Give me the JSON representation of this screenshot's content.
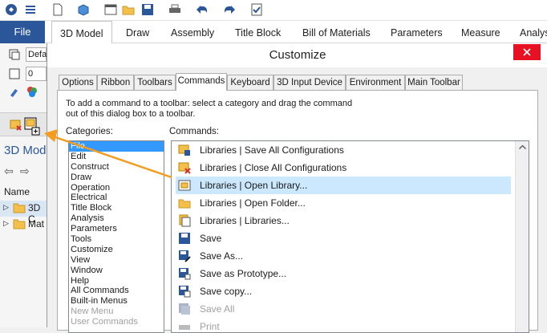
{
  "ribbon": {
    "file": "File",
    "tabs": [
      "3D Model",
      "Draw",
      "Assembly",
      "Title Block",
      "Bill of Materials",
      "Parameters",
      "Measure",
      "Analys"
    ]
  },
  "left": {
    "input1": "Defa",
    "input2": "0",
    "tree_title": "3D Mod",
    "col_name": "Name",
    "tree_items": [
      "3D C",
      "Mat"
    ]
  },
  "dialog": {
    "title": "Customize",
    "tabs": [
      "Options",
      "Ribbon",
      "Toolbars",
      "Commands",
      "Keyboard",
      "3D Input Device",
      "Environment",
      "Main Toolbar"
    ],
    "instructions": "To add a command to a toolbar: select a category and drag the command out of this dialog box to a toolbar.",
    "categories_label": "Categories:",
    "commands_label": "Commands:",
    "categories": [
      "File",
      "Edit",
      "Construct",
      "Draw",
      "Operation",
      "Electrical",
      "Title Block",
      "Analysis",
      "Parameters",
      "Tools",
      "Customize",
      "View",
      "Window",
      "Help",
      "All Commands",
      "Built-in Menus",
      "New Menu",
      "User Commands"
    ],
    "commands": [
      {
        "label": "Libraries | Save All Configurations",
        "icon": "library-save-icon"
      },
      {
        "label": "Libraries | Close All Configurations",
        "icon": "library-close-icon"
      },
      {
        "label": "Libraries | Open Library...",
        "icon": "library-open-icon"
      },
      {
        "label": "Libraries | Open Folder...",
        "icon": "folder-open-icon"
      },
      {
        "label": "Libraries | Libraries...",
        "icon": "libraries-icon"
      },
      {
        "label": "Save",
        "icon": "save-icon"
      },
      {
        "label": "Save As...",
        "icon": "save-as-icon"
      },
      {
        "label": "Save as Prototype...",
        "icon": "save-prototype-icon"
      },
      {
        "label": "Save copy...",
        "icon": "save-copy-icon"
      },
      {
        "label": "Save All",
        "icon": "save-all-icon"
      },
      {
        "label": "Print",
        "icon": "print-icon"
      }
    ]
  },
  "colors": {
    "accent": "#2b579a",
    "selection": "#3399ff",
    "highlight": "#cce8ff",
    "close": "#e81123",
    "arrow": "#f39c1e"
  }
}
